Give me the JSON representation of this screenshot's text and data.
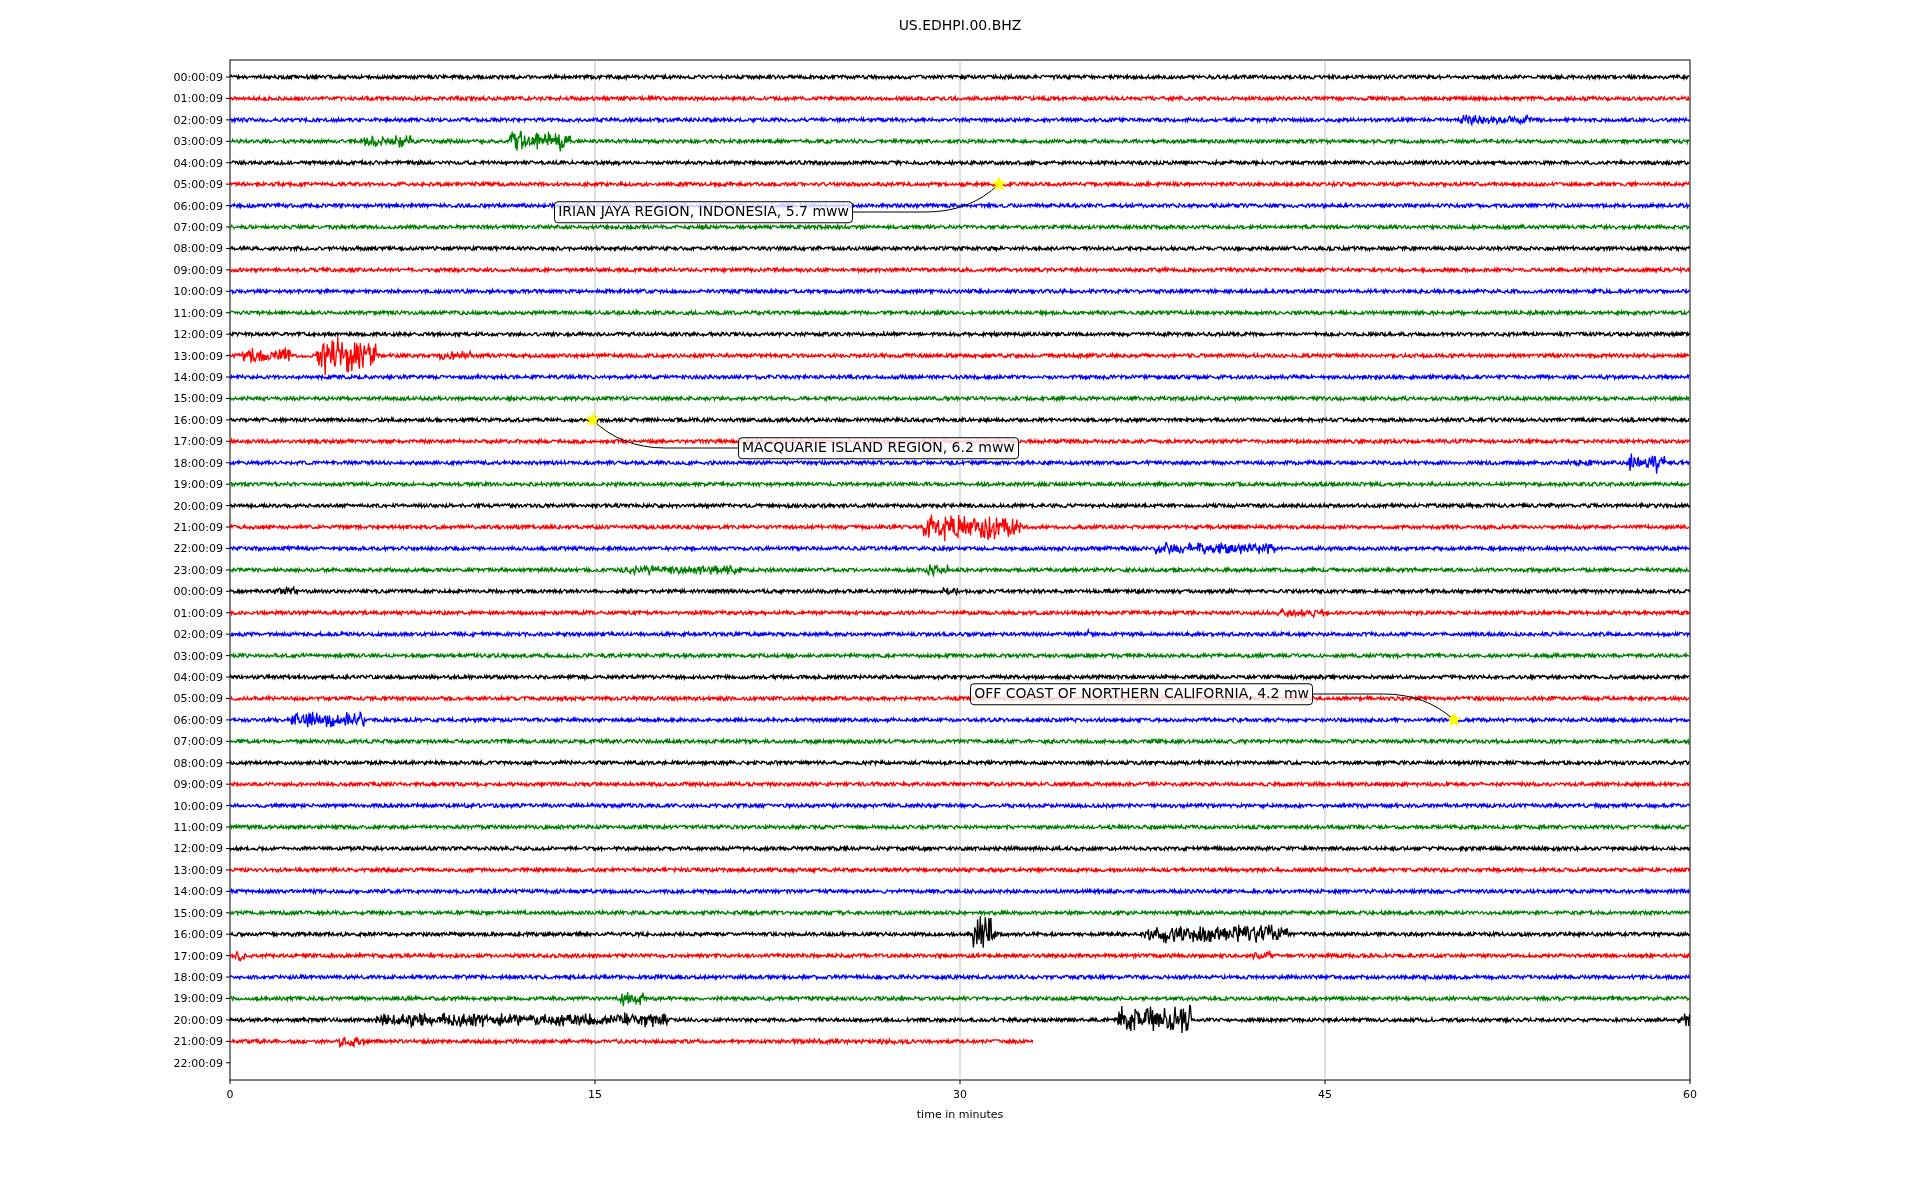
{
  "title": "US.EDHPI.00.BHZ",
  "rows": [
    {
      "label": "00:00:09",
      "color": "#000000",
      "kind": "full"
    },
    {
      "label": "01:00:09",
      "color": "#ff0000",
      "kind": "full"
    },
    {
      "label": "02:00:09",
      "color": "#0000ff",
      "kind": "full"
    },
    {
      "label": "03:00:09",
      "color": "#008000",
      "kind": "full"
    },
    {
      "label": "04:00:09",
      "color": "#000000",
      "kind": "full"
    },
    {
      "label": "05:00:09",
      "color": "#ff0000",
      "kind": "full"
    },
    {
      "label": "06:00:09",
      "color": "#0000ff",
      "kind": "full"
    },
    {
      "label": "07:00:09",
      "color": "#008000",
      "kind": "full"
    },
    {
      "label": "08:00:09",
      "color": "#000000",
      "kind": "full"
    },
    {
      "label": "09:00:09",
      "color": "#ff0000",
      "kind": "full"
    },
    {
      "label": "10:00:09",
      "color": "#0000ff",
      "kind": "full"
    },
    {
      "label": "11:00:09",
      "color": "#008000",
      "kind": "full"
    },
    {
      "label": "12:00:09",
      "color": "#000000",
      "kind": "full"
    },
    {
      "label": "13:00:09",
      "color": "#ff0000",
      "kind": "full"
    },
    {
      "label": "14:00:09",
      "color": "#0000ff",
      "kind": "full"
    },
    {
      "label": "15:00:09",
      "color": "#008000",
      "kind": "full"
    },
    {
      "label": "16:00:09",
      "color": "#000000",
      "kind": "full"
    },
    {
      "label": "17:00:09",
      "color": "#ff0000",
      "kind": "full"
    },
    {
      "label": "18:00:09",
      "color": "#0000ff",
      "kind": "full"
    },
    {
      "label": "19:00:09",
      "color": "#008000",
      "kind": "full"
    },
    {
      "label": "20:00:09",
      "color": "#000000",
      "kind": "full"
    },
    {
      "label": "21:00:09",
      "color": "#ff0000",
      "kind": "full"
    },
    {
      "label": "22:00:09",
      "color": "#0000ff",
      "kind": "full"
    },
    {
      "label": "23:00:09",
      "color": "#008000",
      "kind": "full"
    },
    {
      "label": "00:00:09",
      "color": "#000000",
      "kind": "full"
    },
    {
      "label": "01:00:09",
      "color": "#ff0000",
      "kind": "full"
    },
    {
      "label": "02:00:09",
      "color": "#0000ff",
      "kind": "full"
    },
    {
      "label": "03:00:09",
      "color": "#008000",
      "kind": "full"
    },
    {
      "label": "04:00:09",
      "color": "#000000",
      "kind": "full"
    },
    {
      "label": "05:00:09",
      "color": "#ff0000",
      "kind": "full"
    },
    {
      "label": "06:00:09",
      "color": "#0000ff",
      "kind": "full"
    },
    {
      "label": "07:00:09",
      "color": "#008000",
      "kind": "full"
    },
    {
      "label": "08:00:09",
      "color": "#000000",
      "kind": "full"
    },
    {
      "label": "09:00:09",
      "color": "#ff0000",
      "kind": "full"
    },
    {
      "label": "10:00:09",
      "color": "#0000ff",
      "kind": "full"
    },
    {
      "label": "11:00:09",
      "color": "#008000",
      "kind": "full"
    },
    {
      "label": "12:00:09",
      "color": "#000000",
      "kind": "full"
    },
    {
      "label": "13:00:09",
      "color": "#ff0000",
      "kind": "full"
    },
    {
      "label": "14:00:09",
      "color": "#0000ff",
      "kind": "full"
    },
    {
      "label": "15:00:09",
      "color": "#008000",
      "kind": "full"
    },
    {
      "label": "16:00:09",
      "color": "#000000",
      "kind": "full"
    },
    {
      "label": "17:00:09",
      "color": "#ff0000",
      "kind": "full"
    },
    {
      "label": "18:00:09",
      "color": "#0000ff",
      "kind": "full"
    },
    {
      "label": "19:00:09",
      "color": "#008000",
      "kind": "full"
    },
    {
      "label": "20:00:09",
      "color": "#000000",
      "kind": "full"
    },
    {
      "label": "21:00:09",
      "color": "#ff0000",
      "kind": "partial"
    },
    {
      "label": "22:00:09",
      "kind": "empty"
    }
  ],
  "x_axis": {
    "label": "time in minutes",
    "ticks": [
      "0",
      "15",
      "30",
      "45",
      "60"
    ]
  },
  "events": [
    {
      "text": "IRIAN JAYA REGION, INDONESIA, 5.7 mww"
    },
    {
      "text": "MACQUARIE ISLAND REGION, 6.2 mww"
    },
    {
      "text": "OFF COAST OF NORTHERN CALIFORNIA, 4.2 mw"
    }
  ]
}
